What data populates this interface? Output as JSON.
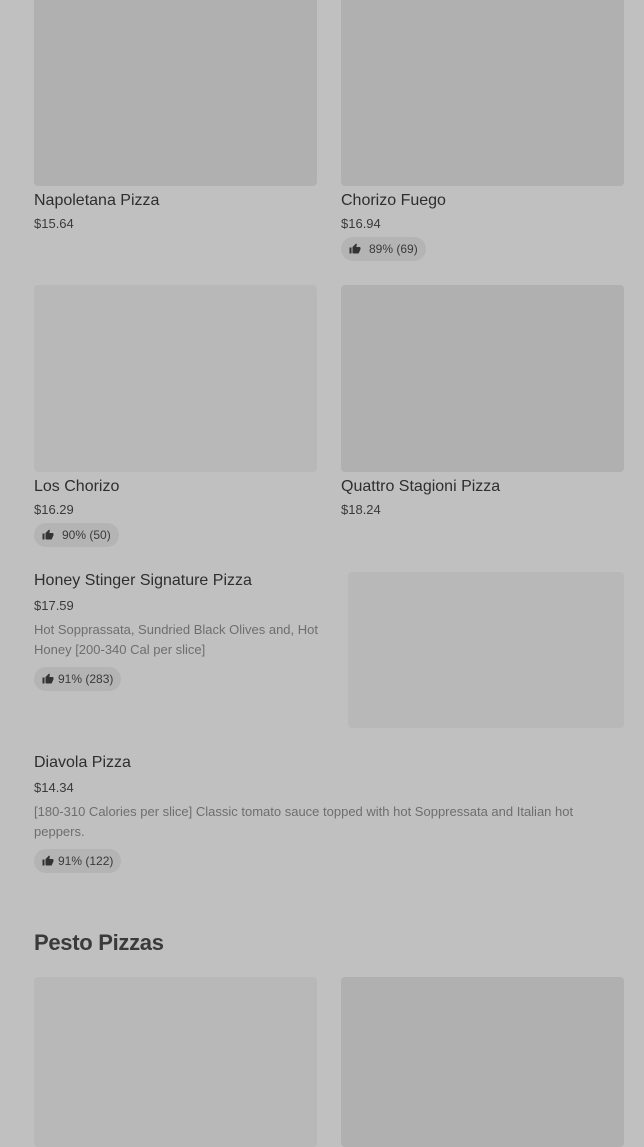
{
  "items": [
    {
      "name": "Napoletana Pizza",
      "price": "$15.64"
    },
    {
      "name": "Chorizo Fuego",
      "price": "$16.94",
      "rating": "89% (69)"
    },
    {
      "name": "Los Chorizo",
      "price": "$16.29",
      "rating": "90% (50)"
    },
    {
      "name": "Quattro Stagioni Pizza",
      "price": "$18.24"
    },
    {
      "name": "Honey Stinger Signature Pizza",
      "price": "$17.59",
      "description": "Hot Sopprassata, Sundried Black Olives and, Hot Honey [200-340 Cal per slice]",
      "rating": "91% (283)"
    },
    {
      "name": "Diavola Pizza",
      "price": "$14.34",
      "description": "[180-310 Calories per slice] Classic tomato sauce topped with hot Soppressata and Italian hot peppers.",
      "rating": "91% (122)"
    }
  ],
  "section": {
    "title": "Pesto Pizzas"
  },
  "icons": {
    "rating": "thumbs-up-icon"
  },
  "colors": {
    "background": "#c0c0c0",
    "placeholder": "#b0b0b0",
    "badge": "#b4b4b4"
  }
}
